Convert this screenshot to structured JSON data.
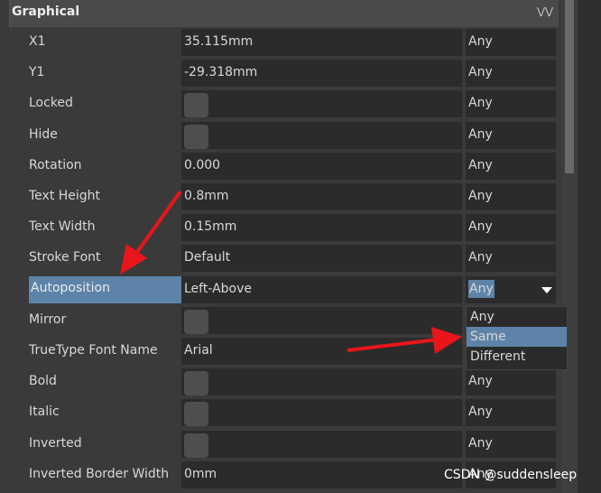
{
  "section": {
    "title": "Graphical",
    "collapse_icon": "double-chevron-icon"
  },
  "rows": [
    {
      "label": "X1",
      "value": "35.115mm",
      "filter": "Any"
    },
    {
      "label": "Y1",
      "value": "-29.318mm",
      "filter": "Any"
    },
    {
      "label": "Locked",
      "checkbox": true,
      "filter": "Any"
    },
    {
      "label": "Hide",
      "checkbox": true,
      "filter": "Any"
    },
    {
      "label": "Rotation",
      "value": "0.000",
      "filter": "Any"
    },
    {
      "label": "Text Height",
      "value": "0.8mm",
      "filter": "Any"
    },
    {
      "label": "Text Width",
      "value": "0.15mm",
      "filter": "Any"
    },
    {
      "label": "Stroke Font",
      "value": "Default",
      "filter": "Any"
    },
    {
      "label": "Autoposition",
      "value": "Left-Above",
      "filter": "Any",
      "selected": true
    },
    {
      "label": "Mirror",
      "checkbox": true,
      "filter": ""
    },
    {
      "label": "TrueType Font Name",
      "value": "Arial",
      "filter": ""
    },
    {
      "label": "Bold",
      "checkbox": true,
      "filter": "Any"
    },
    {
      "label": "Italic",
      "checkbox": true,
      "filter": "Any"
    },
    {
      "label": "Inverted",
      "checkbox": true,
      "filter": "Any"
    },
    {
      "label": "Inverted Border Width",
      "value": "0mm",
      "filter": "Any"
    }
  ],
  "dropdown": {
    "options": [
      "Any",
      "Same",
      "Different"
    ],
    "highlighted": "Same"
  },
  "watermark": "CSDN @suddensleep",
  "colors": {
    "selection": "#5d83a8",
    "annotation_arrow": "#e8161b"
  }
}
